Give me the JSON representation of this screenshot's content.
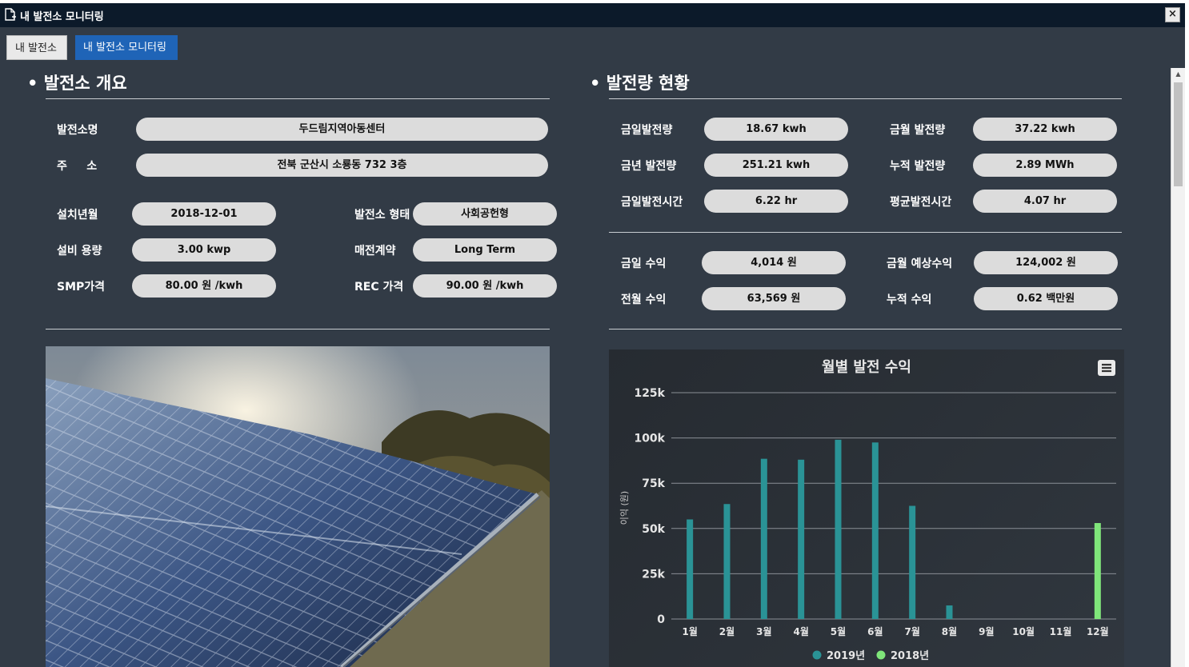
{
  "window": {
    "title": "내 발전소 모니터링",
    "close_label": "×"
  },
  "tabs": [
    {
      "label": "내 발전소"
    },
    {
      "label": "내 발전소 모니터링"
    }
  ],
  "overview": {
    "title": "발전소 개요",
    "plant_name_label": "발전소명",
    "plant_name": "두드림지역아동센터",
    "address_label": "주     소",
    "address": "전북 군산시 소룡동 732 3층",
    "install_date_label": "설치년월",
    "install_date": "2018-12-01",
    "plant_type_label": "발전소 형태",
    "plant_type": "사회공헌형",
    "capacity_label": "설비 용량",
    "capacity": "3.00 kwp",
    "contract_label": "매전계약",
    "contract": "Long Term",
    "smp_label": "SMP가격",
    "smp": "80.00 원 /kwh",
    "rec_label": "REC 가격",
    "rec": "90.00 원 /kwh"
  },
  "generation": {
    "title": "발전량 현황",
    "today_label": "금일발전량",
    "today": "18.67 kwh",
    "month_label": "금월 발전량",
    "month": "37.22 kwh",
    "year_label": "금년 발전량",
    "year": "251.21 kwh",
    "total_label": "누적 발전량",
    "total": "2.89 MWh",
    "today_hours_label": "금일발전시간",
    "today_hours": "6.22 hr",
    "avg_hours_label": "평균발전시간",
    "avg_hours": "4.07 hr",
    "today_revenue_label": "금일 수익",
    "today_revenue": "4,014 원",
    "month_expected_label": "금월 예상수익",
    "month_expected": "124,002 원",
    "prev_month_label": "전월 수익",
    "prev_month": "63,569 원",
    "total_revenue_label": "누적 수익",
    "total_revenue": "0.62 백만원"
  },
  "colors": {
    "series_2019": "#2a9396",
    "series_2018": "#7fe67a",
    "tab_active": "#1f64b7"
  },
  "chart_data": {
    "type": "bar",
    "title": "월별 발전 수익",
    "ylabel": "이익 (원)",
    "xlabel": "",
    "ylim": [
      0,
      125000
    ],
    "yticks": [
      0,
      25000,
      50000,
      75000,
      100000,
      125000
    ],
    "ytick_labels": [
      "0",
      "25k",
      "50k",
      "75k",
      "100k",
      "125k"
    ],
    "categories": [
      "1월",
      "2월",
      "3월",
      "4월",
      "5월",
      "6월",
      "7월",
      "8월",
      "9월",
      "10월",
      "11월",
      "12월"
    ],
    "series": [
      {
        "name": "2019년",
        "color": "#2a9396",
        "values": [
          55000,
          63500,
          88500,
          88000,
          99000,
          97500,
          62500,
          7500,
          null,
          null,
          null,
          null
        ]
      },
      {
        "name": "2018년",
        "color": "#7fe67a",
        "values": [
          null,
          null,
          null,
          null,
          null,
          null,
          null,
          null,
          null,
          null,
          null,
          53000
        ]
      }
    ],
    "grid": true,
    "legend": "bottom",
    "menu_icon": "hamburger-menu-icon"
  }
}
